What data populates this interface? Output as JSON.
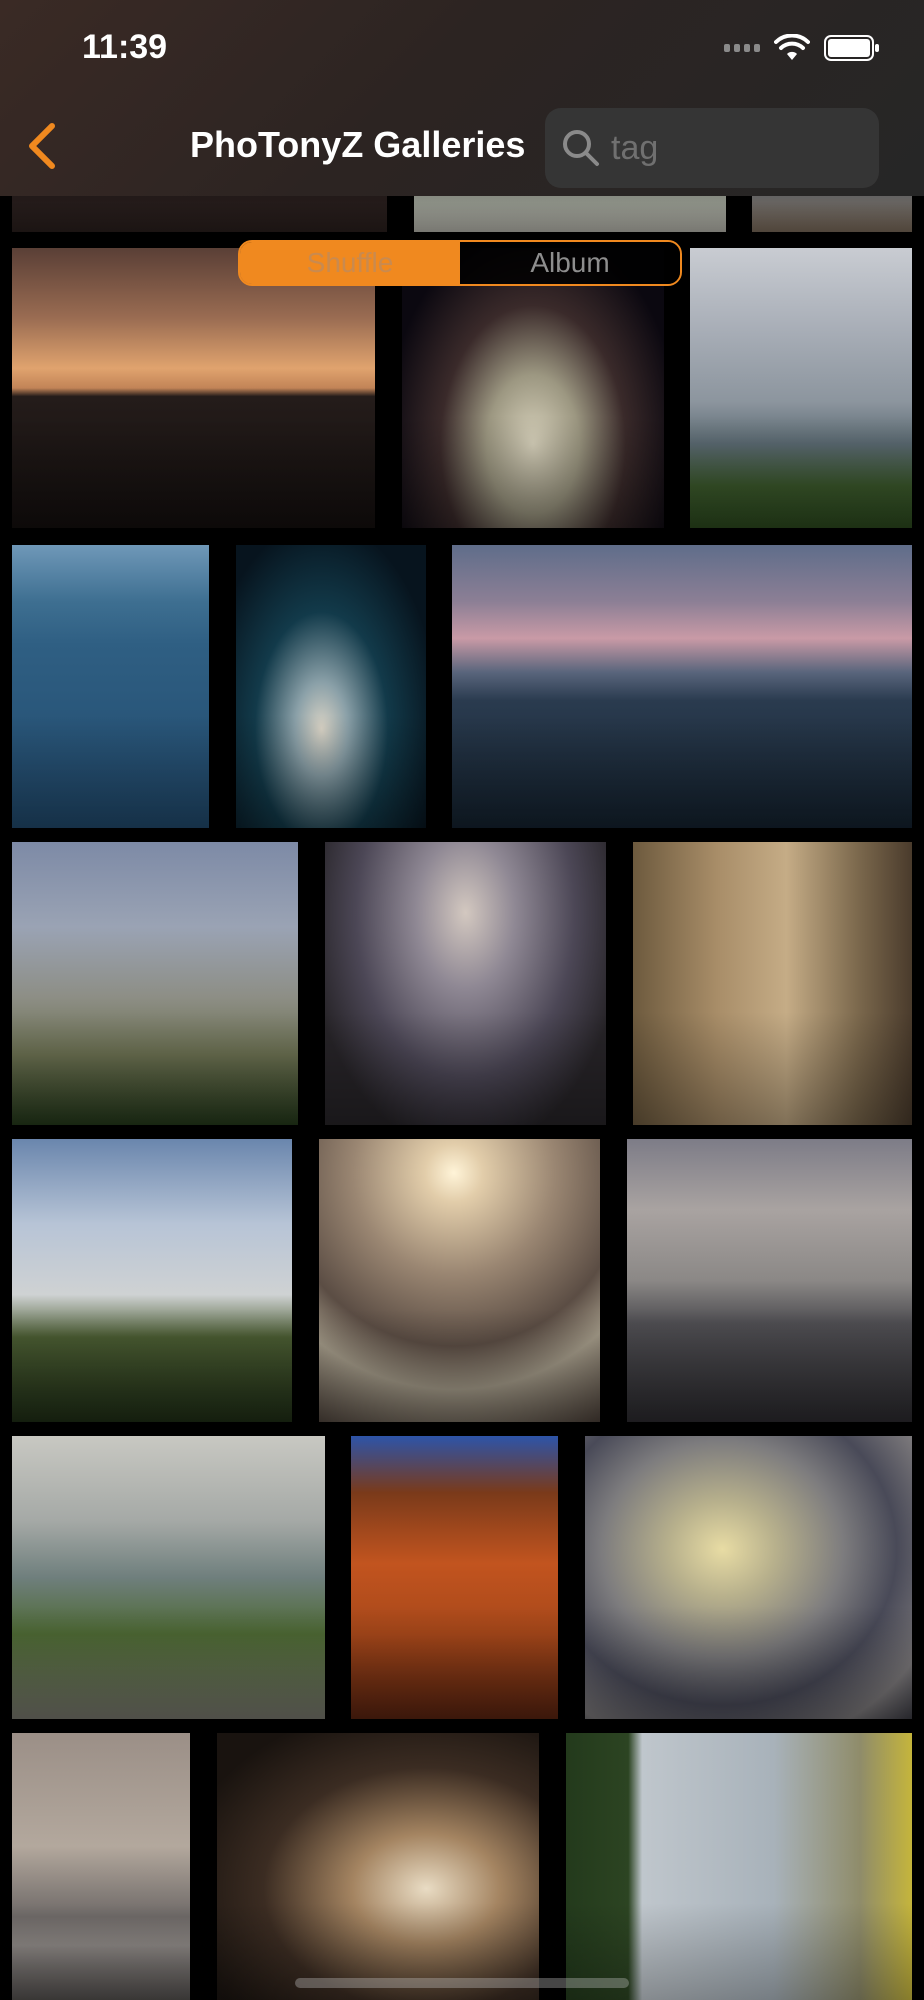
{
  "status_bar": {
    "time": "11:39"
  },
  "nav": {
    "title": "PhoTonyZ Galleries"
  },
  "search": {
    "placeholder": "tag",
    "value": ""
  },
  "segmented": {
    "shuffle_label": "Shuffle",
    "album_label": "Album",
    "selected": "Shuffle"
  },
  "colors": {
    "accent": "#f0891f",
    "header_bg": "#2c2422",
    "background": "#000000"
  },
  "icons": [
    "back-chevron-icon",
    "search-icon",
    "signal-icon",
    "wifi-icon",
    "battery-icon"
  ]
}
